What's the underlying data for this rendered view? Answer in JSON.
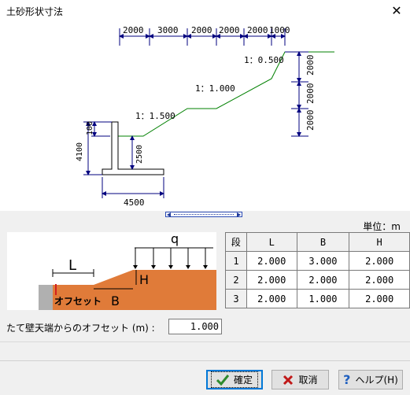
{
  "window": {
    "title": "土砂形状寸法",
    "close_glyph": "✕"
  },
  "top_drawing": {
    "top_dims": [
      "2000",
      "3000",
      "2000",
      "2000",
      "2000",
      "1000"
    ],
    "right_dims": [
      "2000",
      "2000",
      "2000"
    ],
    "slopes": [
      "1：1.500",
      "1：1.000",
      "1：0.500"
    ],
    "wall_dims": {
      "top": "100",
      "height": "4100",
      "offset": "2500",
      "base": "4500"
    },
    "colors": {
      "ground": "#008000",
      "dims": "#00007f",
      "wall": "#000000"
    }
  },
  "unit_label": "単位：m",
  "diagram": {
    "labels": {
      "q": "q",
      "L": "L",
      "H": "H",
      "B": "B",
      "offset": "オフセット"
    },
    "colors": {
      "soil": "#e07b39",
      "offset_marker": "#d02020"
    }
  },
  "table": {
    "headers": [
      "段",
      "L",
      "B",
      "H"
    ],
    "rows": [
      [
        "1",
        "2.000",
        "3.000",
        "2.000"
      ],
      [
        "2",
        "2.000",
        "2.000",
        "2.000"
      ],
      [
        "3",
        "2.000",
        "1.000",
        "2.000"
      ]
    ]
  },
  "offset_field": {
    "label": "たて壁天端からのオフセット (m) :",
    "value": "1.000"
  },
  "buttons": {
    "ok": {
      "label": "確定",
      "icon": "checkmark-icon"
    },
    "cancel": {
      "label": "取消",
      "icon": "x-icon"
    },
    "help": {
      "label": "ヘルプ(H)",
      "icon": "question-icon"
    }
  }
}
